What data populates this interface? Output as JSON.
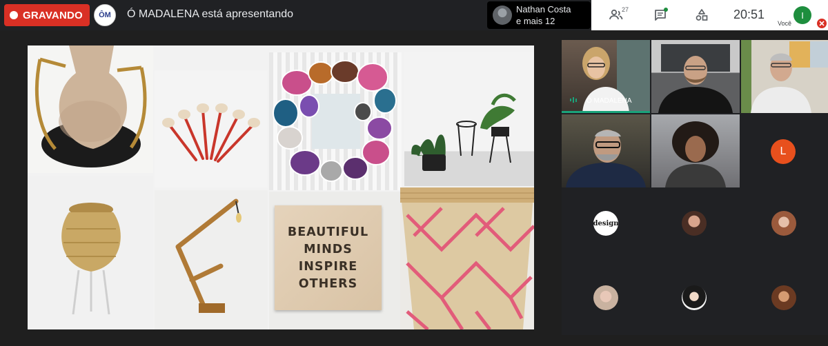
{
  "topbar": {
    "recording_label": "GRAVANDO",
    "presenter_logo": "ÔM",
    "presenting_text": "Ó MADALENA está apresentando",
    "speaker_name": "Nathan Costa",
    "speaker_more": "e mais 12",
    "people_count": "27",
    "clock": "20:51",
    "self_initial": "I",
    "self_label": "Você"
  },
  "presentation": {
    "sign_lines": [
      "BEAUTIFUL",
      "MINDS",
      "INSPIRE",
      "OTHERS"
    ]
  },
  "participants": {
    "active_tile_name": "Ó MADALENA",
    "avatar_initial": "L",
    "design_logo": "design"
  },
  "colors": {
    "recording": "#d93025",
    "speaking": "#1aa37a",
    "self_avatar": "#1e8e3e",
    "initial_avatar": "#e8501d"
  }
}
